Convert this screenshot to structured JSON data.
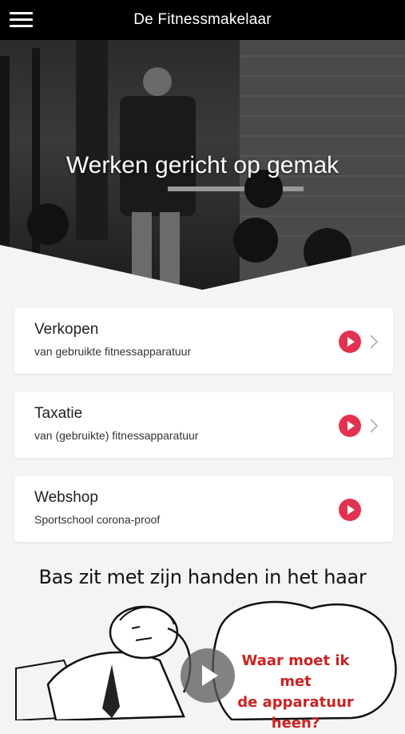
{
  "header": {
    "title": "De Fitnessmakelaar",
    "menu_icon": "hamburger-menu-icon"
  },
  "hero": {
    "title": "Werken gericht op gemak"
  },
  "cards": [
    {
      "title": "Verkopen",
      "subtitle": "van gebruikte fitnessapparatuur",
      "has_chevron": true
    },
    {
      "title": "Taxatie",
      "subtitle": "van (gebruikte) fitnessapparatuur",
      "has_chevron": true
    },
    {
      "title": "Webshop",
      "subtitle": "Sportschool corona-proof",
      "has_chevron": false
    }
  ],
  "video": {
    "title": "Bas zit met zijn handen in het haar",
    "bubble_line1": "Waar moet ik met",
    "bubble_line2": "de apparatuur heen?"
  },
  "colors": {
    "accent": "#e3324f",
    "header_bg": "#000000",
    "page_bg": "#f4f4f6",
    "bubble_text": "#cc2222"
  }
}
